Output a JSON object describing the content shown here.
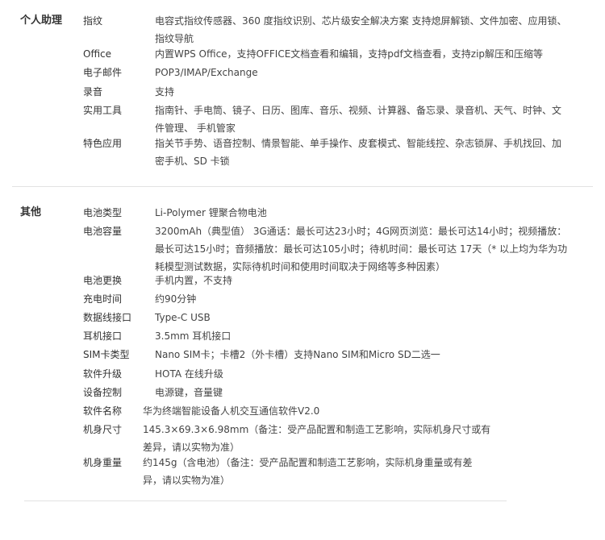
{
  "personal": {
    "title": "个人助理",
    "rows": [
      {
        "label": "指纹",
        "value": "电容式指纹传感器、360 度指纹识别、芯片级安全解决方案 支持熄屏解锁、文件加密、应用锁、指纹导航"
      },
      {
        "label": "Office",
        "value": "内置WPS Office，支持OFFICE文档查看和编辑，支持pdf文档查看，支持zip解压和压缩等"
      },
      {
        "label": "电子邮件",
        "value": "POP3/IMAP/Exchange"
      },
      {
        "label": "录音",
        "value": "支持"
      },
      {
        "label": "实用工具",
        "value": "指南针、手电筒、镜子、日历、图库、音乐、视频、计算器、备忘录、录音机、天气、时钟、文件管理、 手机管家"
      },
      {
        "label": "特色应用",
        "value": "指关节手势、语音控制、情景智能、单手操作、皮套模式、智能线控、杂志锁屏、手机找回、加密手机、SD 卡锁"
      }
    ]
  },
  "other": {
    "title": "其他",
    "rows": [
      {
        "label": "电池类型",
        "value": "Li-Polymer 锂聚合物电池"
      },
      {
        "label": "电池容量",
        "value": "3200mAh（典型值） 3G通话：最长可达23小时；4G网页浏览：最长可达14小时；视频播放：最长可达15小时；音频播放：最长可达105小时；待机时间：最长可达 17天（* 以上均为华为功耗模型测试数据，实际待机时间和使用时间取决于网络等多种因素）"
      },
      {
        "label": "电池更换",
        "value": "手机内置，不支持"
      },
      {
        "label": "充电时间",
        "value": "约90分钟"
      },
      {
        "label": "数据线接口",
        "value": "Type-C USB"
      },
      {
        "label": "耳机接口",
        "value": "3.5mm 耳机接口"
      },
      {
        "label": "SIM卡类型",
        "value": "Nano SIM卡；卡槽2（外卡槽）支持Nano SIM和Micro SD二选一"
      },
      {
        "label": "软件升级",
        "value": "HOTA 在线升级"
      },
      {
        "label": "设备控制",
        "value": "电源键，音量键"
      },
      {
        "label": "软件名称",
        "value": "华为终端智能设备人机交互通信软件V2.0"
      },
      {
        "label": "机身尺寸",
        "value": "145.3×69.3×6.98mm（备注：受产品配置和制造工艺影响，实际机身尺寸或有差异，请以实物为准）"
      },
      {
        "label": "机身重量",
        "value": "约145g（含电池）（备注：受产品配置和制造工艺影响，实际机身重量或有差异，请以实物为准）"
      }
    ]
  }
}
